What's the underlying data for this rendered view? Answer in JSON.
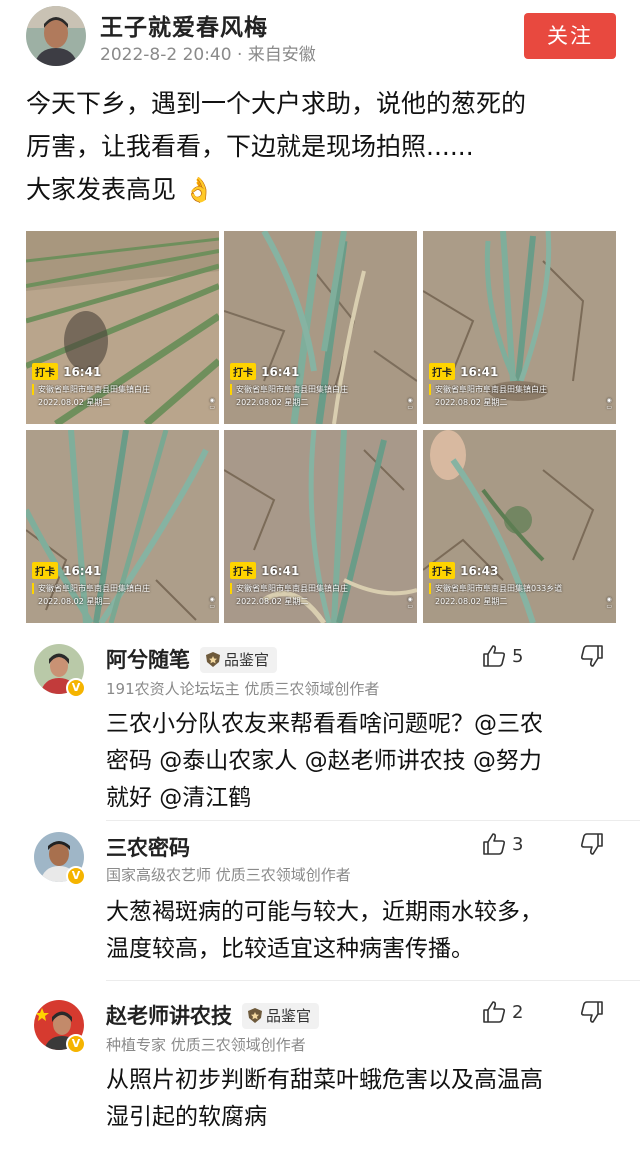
{
  "post": {
    "author": "王子就爱春风梅",
    "meta": "2022-8-2 20:40 · 来自安徽",
    "follow_label": "关注",
    "body_lines": [
      "今天下乡，遇到一个大户求助，说他的葱死的",
      "厉害，让我看看，下边就是现场拍照......",
      "大家发表高见"
    ],
    "emoji": "👌"
  },
  "photos": [
    {
      "tag": "打卡",
      "time": "16:41",
      "location": "安徽省阜阳市阜南县田集镇白庄",
      "date": "2022.08.02 星期二"
    },
    {
      "tag": "打卡",
      "time": "16:41",
      "location": "安徽省阜阳市阜南县田集镇白庄",
      "date": "2022.08.02 星期二"
    },
    {
      "tag": "打卡",
      "time": "16:41",
      "location": "安徽省阜阳市阜南县田集镇白庄",
      "date": "2022.08.02 星期二"
    },
    {
      "tag": "打卡",
      "time": "16:41",
      "location": "安徽省阜阳市阜南县田集镇白庄",
      "date": "2022.08.02 星期二"
    },
    {
      "tag": "打卡",
      "time": "16:41",
      "location": "安徽省阜阳市阜南县田集镇白庄",
      "date": "2022.08.02 星期二"
    },
    {
      "tag": "打卡",
      "time": "16:43",
      "location": "安徽省阜阳市阜南县田集镇033乡道",
      "date": "2022.08.02 星期二"
    }
  ],
  "comments": [
    {
      "name": "阿兮随笔",
      "badge": "品鉴官",
      "subtitle": "191农资人论坛坛主 优质三农领域创作者",
      "likes": "5",
      "lines": [
        "三农小分队农友来帮看看啥问题呢？@三农",
        "密码 @泰山农家人 @赵老师讲农技 @努力",
        "就好 @清江鹤"
      ]
    },
    {
      "name": "三农密码",
      "badge": "",
      "subtitle": "国家高级农艺师 优质三农领域创作者",
      "likes": "3",
      "lines": [
        "大葱褐斑病的可能与较大，近期雨水较多，",
        "温度较高，比较适宜这种病害传播。"
      ]
    },
    {
      "name": "赵老师讲农技",
      "badge": "品鉴官",
      "subtitle": "种植专家 优质三农领域创作者",
      "likes": "2",
      "lines": [
        "从照片初步判断有甜菜叶蛾危害以及高温高",
        "湿引起的软腐病"
      ]
    }
  ],
  "colors": {
    "follow_bg": "#e8493f",
    "verified_badge": "#f5b400",
    "stamp_yellow": "#ffd400",
    "meta_gray": "#8a8a8a"
  }
}
